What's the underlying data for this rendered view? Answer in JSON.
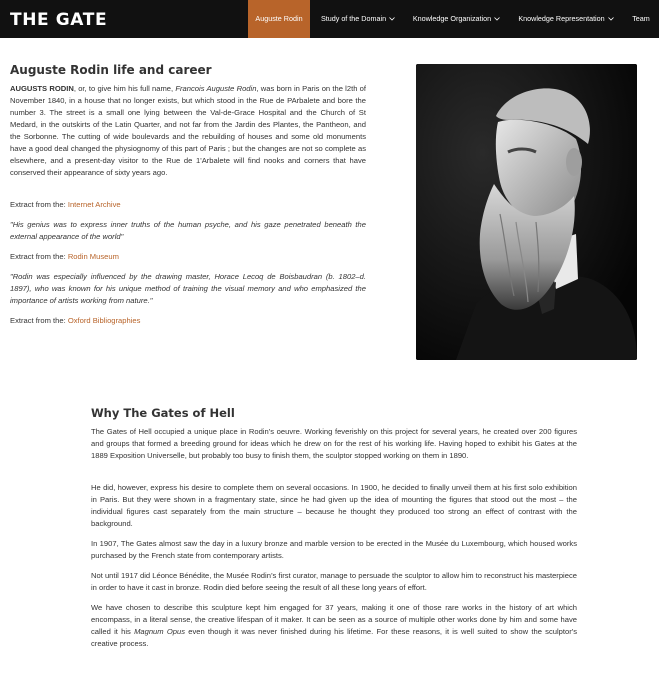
{
  "nav": {
    "brand": "THE GATE",
    "items": [
      {
        "label": "Auguste Rodin",
        "active": true,
        "dropdown": false
      },
      {
        "label": "Study of the Domain",
        "active": false,
        "dropdown": true
      },
      {
        "label": "Knowledge Organization",
        "active": false,
        "dropdown": true
      },
      {
        "label": "Knowledge Representation",
        "active": false,
        "dropdown": true
      },
      {
        "label": "Team",
        "active": false,
        "dropdown": false
      }
    ]
  },
  "colors": {
    "accent": "#b8642a",
    "navbar": "#111111"
  },
  "intro": {
    "title": "Auguste Rodin life and career",
    "name_bold": "AUGUSTS RODIN",
    "text_a": ", or, to give him his full name, ",
    "full_name_italic": "Francois Auguste Rodin",
    "text_b": ", was born in Paris on the l2th of November 1840, in a house that no longer exists, but which stood in the Rue de PArbalete and bore the number 3. The street is a small one lying between the Val-de-Grace Hospital and the Church of St Medard, in the outskirts of the Latin Quarter, and not far from the Jardin des Plantes, the Pantheon, and the Sorbonne. The cutting of wide boulevards and the rebuilding of houses and some old monuments have a good deal changed the physiognomy of this part of Paris ; but the changes are not so complete as elsewhere, and a present-day visitor to the Rue de 1'Arbalete will find nooks and corners that have conserved their appearance of sixty years ago.",
    "extract_prefix": "Extract from the: ",
    "source1": "Internet Archive",
    "quote1": "\"His genius was to express inner truths of the human psyche, and his gaze penetrated beneath the external appearance of the world\"",
    "source2": "Rodin Museum",
    "quote2": "\"Rodin was especially influenced by the drawing master, Horace Lecoq de Boisbaudran (b. 1802–d. 1897), who was known for his unique method of training the visual memory and who emphasized the importance of artists working from nature.\"",
    "source3": "Oxford Bibliographies"
  },
  "gates": {
    "title": "Why The Gates of Hell",
    "p1": "The Gates of Hell occupied a unique place in Rodin’s oeuvre. Working feverishly on this project for several years, he created over 200 figures and groups that formed a breeding ground for ideas which he drew on for the rest of his working life. Having hoped to exhibit his Gates at the 1889 Exposition Universelle, but probably too busy to finish them, the sculptor stopped working on them in 1890.",
    "p2": "He did, however, express his desire to complete them on several occasions. In 1900, he decided to finally unveil them at his first solo exhibition in Paris. But they were shown in a fragmentary state, since he had given up the idea of mounting the figures that stood out the most – the individual figures cast separately from the main structure – because he thought they produced too strong an effect of contrast with the background.",
    "p3": "In 1907, The Gates almost saw the day in a luxury bronze and marble version to be erected in the Musée du Luxembourg, which housed works purchased by the French state from contemporary artists.",
    "p4": "Not until 1917 did Léonce Bénédite, the Musée Rodin’s first curator, manage to persuade the sculptor to allow him to reconstruct his masterpiece in order to have it cast in bronze. Rodin died before seeing the result of all these long years of effort.",
    "p5a": "We have chosen to describe this sculpture kept him engaged for 37 years, making it one of those rare works in the history of art which encompass, in a literal sense, the creative lifespan of it maker. It can be seen as a source of multiple other works done by him and some have called it his ",
    "p5_italic": "Magnum Opus",
    "p5b": " even though it was never finished during his lifetime. For these reasons, it is well suited to show the sculptor's creative process."
  }
}
